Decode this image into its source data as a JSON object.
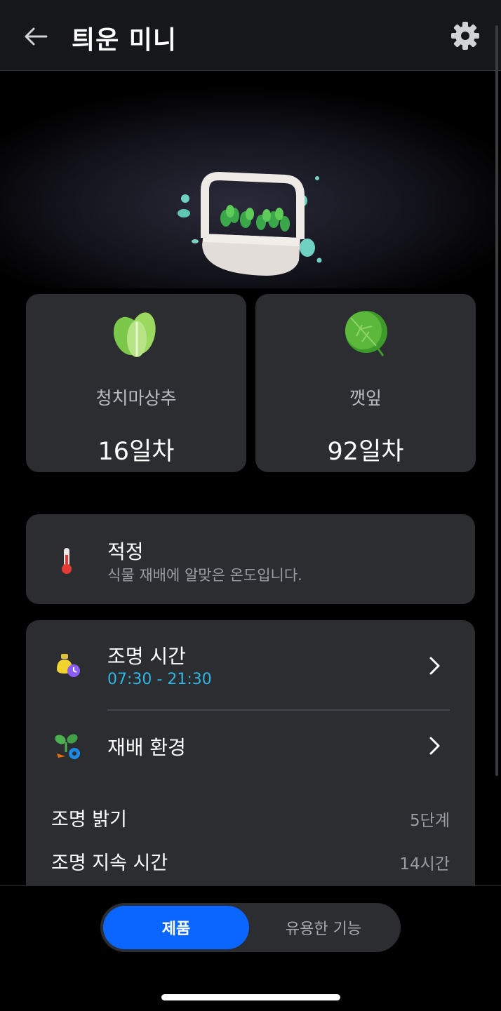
{
  "header": {
    "title": "틔운 미니"
  },
  "plants": [
    {
      "name": "청치마상추",
      "days": "16일차",
      "icon": "lettuce-icon",
      "color": "#8fd14f"
    },
    {
      "name": "깻잎",
      "days": "92일차",
      "icon": "perilla-leaf-icon",
      "color": "#4caf2e"
    }
  ],
  "temperature": {
    "status": "적정",
    "description": "식물 재배에 알맞은 온도입니다."
  },
  "lighting": {
    "label": "조명 시간",
    "time": "07:30 - 21:30"
  },
  "environment": {
    "label": "재배 환경",
    "items": [
      {
        "label": "조명 밝기",
        "value": "5단계"
      },
      {
        "label": "조명 지속 시간",
        "value": "14시간"
      }
    ]
  },
  "tabs": {
    "active": "제품",
    "other": "유용한 기능"
  },
  "colors": {
    "accent": "#0a66ff",
    "time_text": "#2fb6e6",
    "card": "#2b2d31"
  }
}
